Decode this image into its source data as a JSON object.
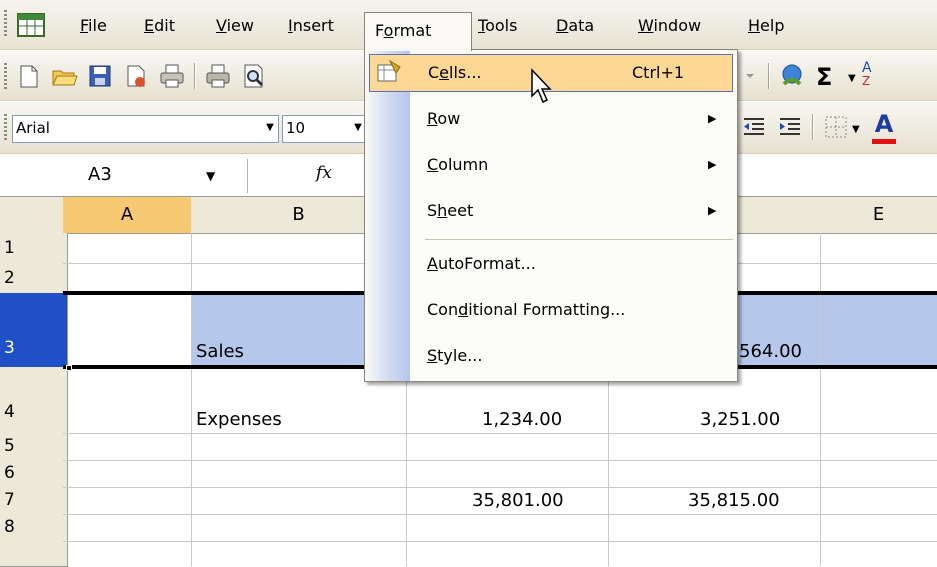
{
  "menubar": {
    "items": [
      {
        "pre": "",
        "ul": "F",
        "post": "ile"
      },
      {
        "pre": "",
        "ul": "E",
        "post": "dit"
      },
      {
        "pre": "",
        "ul": "V",
        "post": "iew"
      },
      {
        "pre": "",
        "ul": "I",
        "post": "nsert"
      },
      {
        "pre": "F",
        "ul": "o",
        "post": "rmat"
      },
      {
        "pre": "",
        "ul": "T",
        "post": "ools"
      },
      {
        "pre": "",
        "ul": "D",
        "post": "ata"
      },
      {
        "pre": "",
        "ul": "W",
        "post": "indow"
      },
      {
        "pre": "",
        "ul": "H",
        "post": "elp"
      }
    ]
  },
  "toolbar": {
    "font_name": "Arial",
    "font_size": "10",
    "sigma": "Σ",
    "sort_glyph": "A",
    "font_color_glyph": "A"
  },
  "formula_bar": {
    "name_box": "A3",
    "fx": "fx"
  },
  "grid": {
    "columns": [
      "A",
      "B",
      "",
      "",
      "E"
    ],
    "rows": [
      "1",
      "2",
      "3",
      "4",
      "5",
      "6",
      "7",
      "8"
    ],
    "cells": {
      "b3": "Sales",
      "d3": "564.00",
      "b4": "Expenses",
      "c4": "1,234.00",
      "d4": "3,251.00",
      "c7": "35,801.00",
      "d7": "35,815.00"
    }
  },
  "format_menu": {
    "cells": {
      "pre": "C",
      "ul": "e",
      "post": "lls...",
      "shortcut": "Ctrl+1"
    },
    "row": {
      "pre": "",
      "ul": "R",
      "post": "ow"
    },
    "column": {
      "pre": "",
      "ul": "C",
      "post": "olumn"
    },
    "sheet": {
      "pre": "S",
      "ul": "h",
      "post": "eet"
    },
    "autoformat": {
      "pre": "",
      "ul": "A",
      "post": "utoFormat..."
    },
    "conditional": {
      "pre": "Con",
      "ul": "d",
      "post": "itional Formatting..."
    },
    "style": {
      "pre": "",
      "ul": "S",
      "post": "tyle..."
    }
  },
  "colors": {
    "selected_header": "#f8c973",
    "selected_row": "#2050c8",
    "menu_highlight": "#fcd894"
  }
}
